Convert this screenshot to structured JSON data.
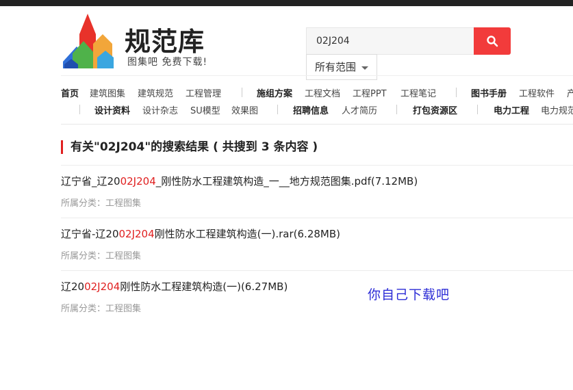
{
  "logo": {
    "title": "规范库",
    "subtitle": "图集吧 免费下载!"
  },
  "search": {
    "value": "02J204",
    "placeholder": "",
    "scope_selected": "所有范围"
  },
  "nav": {
    "row1": [
      {
        "label": "首页",
        "bold": true
      },
      {
        "label": "建筑图集",
        "bold": false
      },
      {
        "label": "建筑规范",
        "bold": false
      },
      {
        "label": "工程管理",
        "bold": false
      },
      {
        "label": "施组方案",
        "bold": true
      },
      {
        "label": "工程文档",
        "bold": false
      },
      {
        "label": "工程PPT",
        "bold": false
      },
      {
        "label": "工程笔记",
        "bold": false
      },
      {
        "label": "图书手册",
        "bold": true
      },
      {
        "label": "工程软件",
        "bold": false
      },
      {
        "label": "产",
        "bold": false
      }
    ],
    "row2": [
      {
        "label": "设计资料",
        "bold": true
      },
      {
        "label": "设计杂志",
        "bold": false
      },
      {
        "label": "SU模型",
        "bold": false
      },
      {
        "label": "效果图",
        "bold": false
      },
      {
        "label": "招聘信息",
        "bold": true
      },
      {
        "label": "人才简历",
        "bold": false
      },
      {
        "label": "打包资源区",
        "bold": true
      },
      {
        "label": "电力工程",
        "bold": true
      },
      {
        "label": "电力规范",
        "bold": false
      }
    ]
  },
  "results": {
    "heading": "有关\"02J204\"的搜索结果 ( 共搜到 3 条内容 )",
    "items": [
      {
        "title_pre": "辽宁省_辽20",
        "title_hl": "02J204",
        "title_post": "_刚性防水工程建筑构造_一__地方规范图集.pdf(7.12MB)",
        "category": "所属分类：工程图集"
      },
      {
        "title_pre": "辽宁省-辽20",
        "title_hl": "02J204",
        "title_post": "刚性防水工程建筑构造(一).rar(6.28MB)",
        "category": "所属分类：工程图集"
      },
      {
        "title_pre": "辽20",
        "title_hl": "02J204",
        "title_post": "刚性防水工程建筑构造(一)(6.27MB)",
        "category": "所属分类：工程图集"
      }
    ]
  },
  "annotation": "你自己下载吧",
  "colors": {
    "accent": "#f23b3b",
    "highlight": "#e02020",
    "annotation": "#2b2bd6"
  },
  "icons": {
    "search": "magnifier-icon",
    "scope": "caret-down-icon"
  }
}
